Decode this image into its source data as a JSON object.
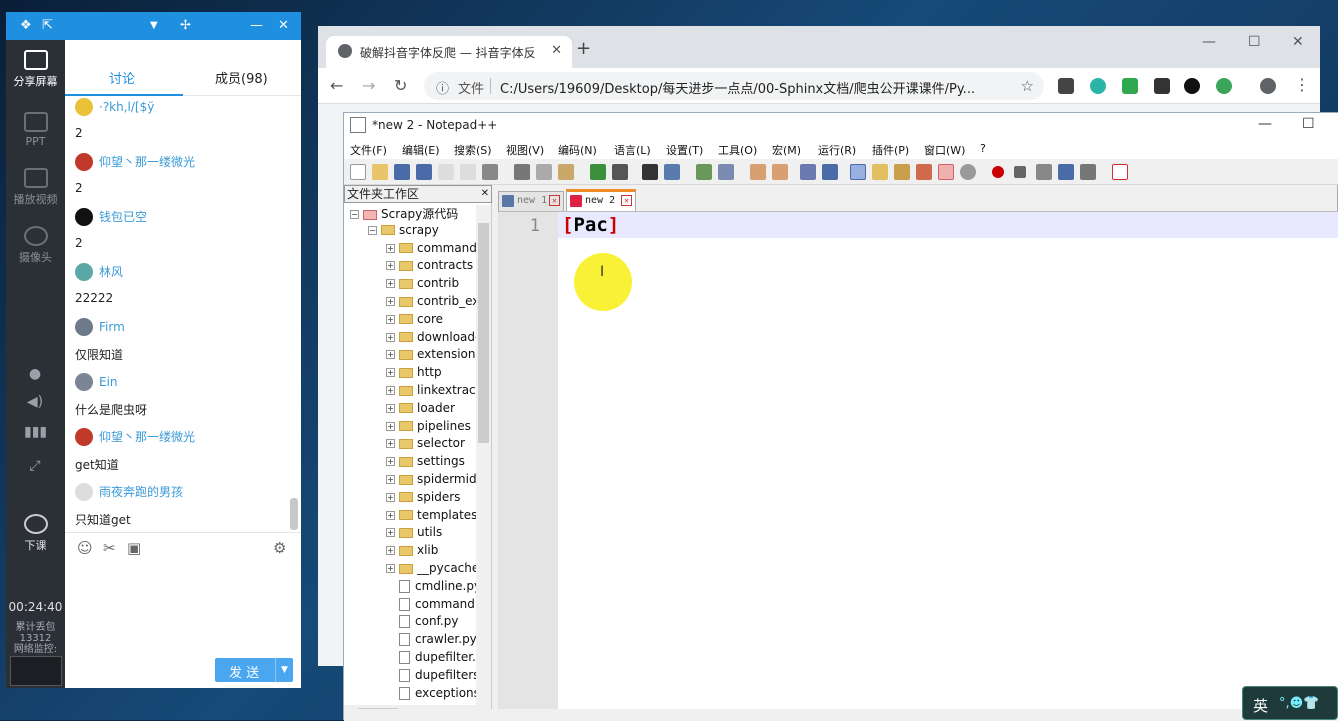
{
  "rail": {
    "share_screen": "分享屏幕",
    "ppt": "PPT",
    "play_video": "播放视频",
    "camera": "摄像头",
    "end_class": "下课",
    "timer": "00:24:40",
    "packet_loss_label": "累计丢包",
    "packet_loss_value": "13312",
    "network_monitor": "网络监控:"
  },
  "chat": {
    "tab_discussion": "讨论",
    "tab_members": "成员(98)",
    "messages": [
      {
        "user": "·?kh,l/[$ÿ",
        "text": "2"
      },
      {
        "user": "仰望丶那一缕微光",
        "text": "2"
      },
      {
        "user": "钱包已空",
        "text": "2"
      },
      {
        "user": "林风",
        "text": "22222"
      },
      {
        "user": "Firm",
        "text": "仅限知道"
      },
      {
        "user": "Ein",
        "text": "什么是爬虫呀"
      },
      {
        "user": "仰望丶那一缕微光",
        "text": "get知道"
      },
      {
        "user": "雨夜奔跑的男孩",
        "text": "只知道get"
      }
    ],
    "send_label": "发 送"
  },
  "browser": {
    "tab_title": "破解抖音字体反爬 — 抖音字体反",
    "file_label": "文件",
    "url": "C:/Users/19609/Desktop/每天进步一点点/00-Sphinx文档/爬虫公开课课件/Py..."
  },
  "notepad": {
    "title": "*new 2 - Notepad++",
    "menus": [
      "文件(F)",
      "编辑(E)",
      "搜索(S)",
      "视图(V)",
      "编码(N)",
      "语言(L)",
      "设置(T)",
      "工具(O)",
      "宏(M)",
      "运行(R)",
      "插件(P)",
      "窗口(W)",
      "?"
    ],
    "folder_panel_title": "文件夹工作区",
    "tree": [
      {
        "label": "Scrapy源代码",
        "depth": 0,
        "kind": "root"
      },
      {
        "label": "scrapy",
        "depth": 1,
        "kind": "folder"
      },
      {
        "label": "commands",
        "depth": 2,
        "kind": "folder"
      },
      {
        "label": "contracts",
        "depth": 2,
        "kind": "folder"
      },
      {
        "label": "contrib",
        "depth": 2,
        "kind": "folder"
      },
      {
        "label": "contrib_exp",
        "depth": 2,
        "kind": "folder"
      },
      {
        "label": "core",
        "depth": 2,
        "kind": "folder"
      },
      {
        "label": "downloader",
        "depth": 2,
        "kind": "folder"
      },
      {
        "label": "extensions",
        "depth": 2,
        "kind": "folder"
      },
      {
        "label": "http",
        "depth": 2,
        "kind": "folder"
      },
      {
        "label": "linkextractors",
        "depth": 2,
        "kind": "folder"
      },
      {
        "label": "loader",
        "depth": 2,
        "kind": "folder"
      },
      {
        "label": "pipelines",
        "depth": 2,
        "kind": "folder"
      },
      {
        "label": "selector",
        "depth": 2,
        "kind": "folder"
      },
      {
        "label": "settings",
        "depth": 2,
        "kind": "folder"
      },
      {
        "label": "spidermiddlewares",
        "depth": 2,
        "kind": "folder"
      },
      {
        "label": "spiders",
        "depth": 2,
        "kind": "folder"
      },
      {
        "label": "templates",
        "depth": 2,
        "kind": "folder"
      },
      {
        "label": "utils",
        "depth": 2,
        "kind": "folder"
      },
      {
        "label": "xlib",
        "depth": 2,
        "kind": "folder"
      },
      {
        "label": "__pycache__",
        "depth": 2,
        "kind": "folder"
      },
      {
        "label": "cmdline.py",
        "depth": 2,
        "kind": "file"
      },
      {
        "label": "command.py",
        "depth": 2,
        "kind": "file"
      },
      {
        "label": "conf.py",
        "depth": 2,
        "kind": "file"
      },
      {
        "label": "crawler.py",
        "depth": 2,
        "kind": "file"
      },
      {
        "label": "dupefilter.py",
        "depth": 2,
        "kind": "file"
      },
      {
        "label": "dupefilters.py",
        "depth": 2,
        "kind": "file"
      },
      {
        "label": "exceptions.py",
        "depth": 2,
        "kind": "file"
      }
    ],
    "tabs": [
      "new 1",
      "new 2"
    ],
    "line_number": "1",
    "code_open": "[",
    "code_text": "Pac",
    "code_close": "]"
  },
  "ime": {
    "label": "英",
    "symbols": "°,☻👕"
  }
}
